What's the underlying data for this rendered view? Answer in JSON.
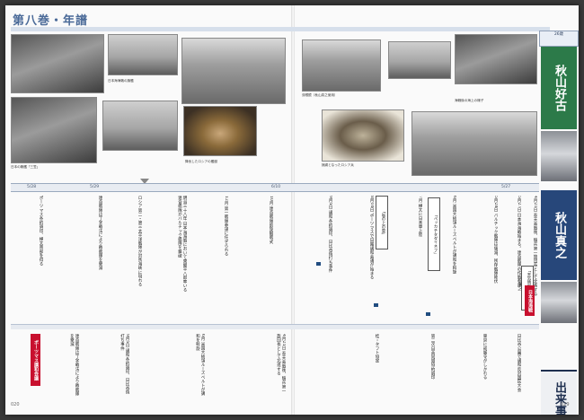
{
  "volume_title": "第八巻・年譜",
  "person_yoshifuru": "秋山好古",
  "person_saneyuki": "秋山真之",
  "events_label": "出来事",
  "age_tab": {
    "line1": "26歳",
    "line2": ""
  },
  "red_tag": "日本海海戦",
  "red_tag_left": "ポーツマス講和会議",
  "page_left": "020",
  "page_right": "029",
  "timeline_dates": [
    "5/28",
    "5/29",
    "6/10",
    "5/27"
  ],
  "captions": [
    "日本の戦艦「三笠」",
    "日本海海戦の旗艦",
    "降伏したロシアの艦艇",
    "双眼鏡（秋山真之使用）",
    "捕虜となったロシア兵",
    "海戦後の海上の様子"
  ],
  "callout_boxes": [
    "「天気晴朗ナレドモ浪高シ」",
    "「ペッカチタダイネフ」",
    "「坂の上の雲」"
  ],
  "columns_upper": [
    "4月21日 奉天会戦後、騎兵第一旅団長として北進する",
    "5月27日 日本海海戦始まる。連合艦隊の作戦参謀",
    "5月28日 バルチック艦隊は壊滅、残存艦隊降伏",
    "6月 米国大統領ルーズベルトが講和を斡旋",
    "7月 樺太に日本軍上陸",
    "8月10日 ポーツマスで日露講和会議が始まる",
    "9月5日 講和条約調印、日比谷焼打ち事件",
    "10月 連合艦隊凱旋観艦式",
    "12月 第一艦隊参謀に任ぜられる"
  ],
  "columns_lower": [
    "明治三十八年 日本海海戦において東郷平八郎率いる連合艦隊がバルチック艦隊を撃破",
    "ロシア第二・第三太平洋艦隊が対馬海峡に現れる",
    "連合艦隊は丁字戦法により敵艦隊を撃滅",
    "ポーツマス条約調印、樺太南部を得る",
    "日比谷公園で講和反対国民大会",
    "東京に戒厳令がしかれる",
    "第二次日英同盟協約調印",
    "桂・タフト協定"
  ]
}
